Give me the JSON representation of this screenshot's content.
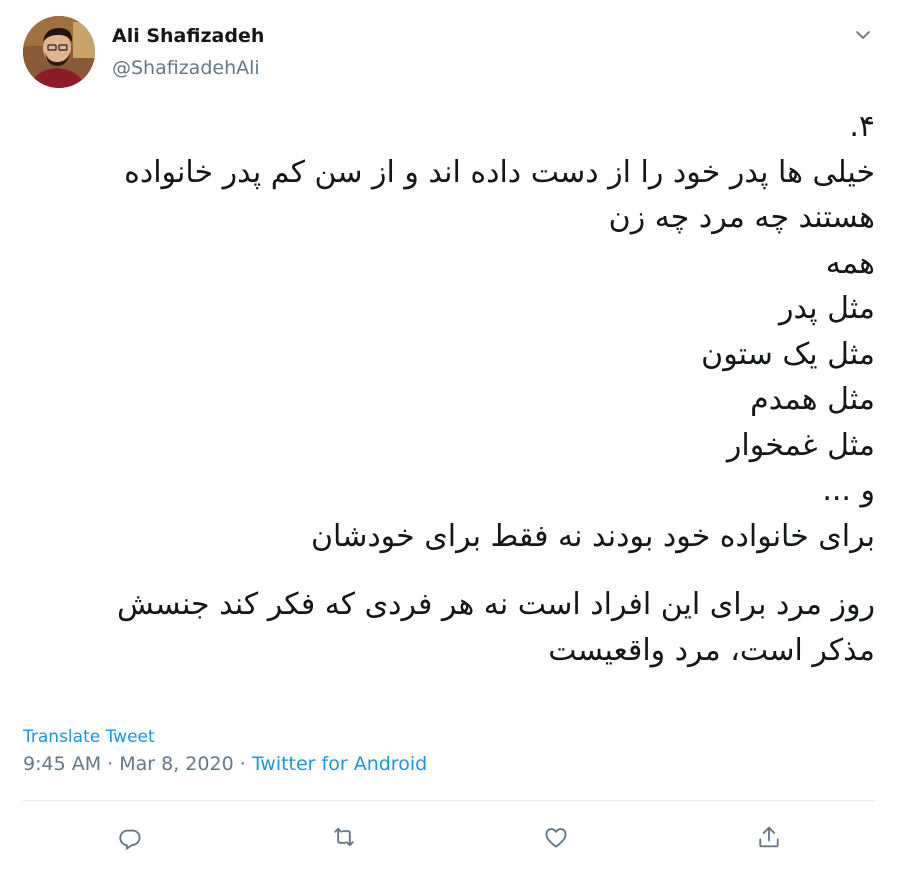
{
  "author": {
    "display_name": "Ali Shafizadeh",
    "handle": "@ShafizadehAli"
  },
  "tweet": {
    "lines": [
      "۴.",
      "خیلی ها پدر خود را از دست داده اند و از سن کم پدر خانواده",
      "هستند چه مرد چه زن",
      "همه",
      "مثل پدر",
      "مثل یک ستون",
      "مثل همدم",
      "مثل غمخوار",
      "و ...",
      "برای خانواده خود بودند نه فقط برای خودشان",
      "",
      "روز مرد برای این افراد است نه هر فردی که فکر کند جنسش",
      "مذکر است، مرد واقعیست"
    ],
    "translate_label": "Translate Tweet",
    "time": "9:45 AM",
    "separator": "·",
    "date": "Mar 8, 2020",
    "source": "Twitter for Android"
  },
  "actions": {
    "reply_icon": "reply-icon",
    "retweet_icon": "retweet-icon",
    "like_icon": "heart-icon",
    "share_icon": "share-icon"
  },
  "colors": {
    "text": "#14171a",
    "secondary": "#657786",
    "link": "#1b95e0",
    "divider": "#e6ecf0"
  }
}
